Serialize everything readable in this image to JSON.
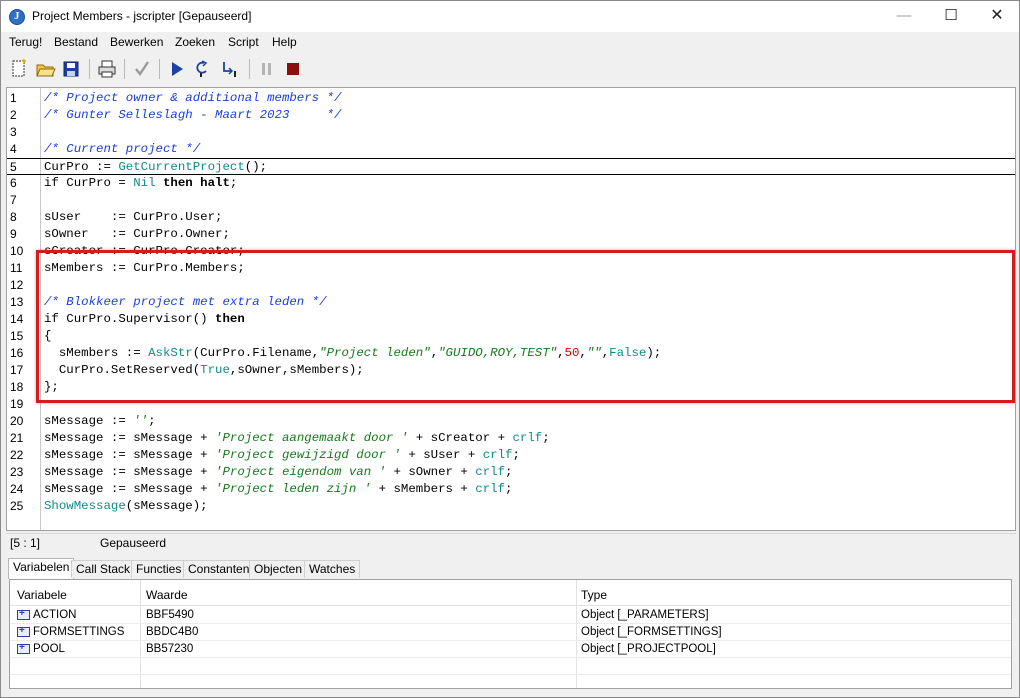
{
  "window": {
    "title": "Project Members - jscripter [Gepauseerd]",
    "controls": {
      "minimize": "—",
      "maximize": "☐",
      "close": "✕"
    }
  },
  "menu": [
    "Terug!",
    "Bestand",
    "Bewerken",
    "Zoeken",
    "Script",
    "Help"
  ],
  "toolbar": [
    "new-icon",
    "open-folder-icon",
    "save-icon",
    "print-icon",
    "check-icon",
    "run-icon",
    "step-over-icon",
    "step-into-icon",
    "pause-icon",
    "stop-icon"
  ],
  "editor": {
    "current_line": 5,
    "lines": [
      {
        "n": "1",
        "html": "<span class=\"cm\">/* Project owner &amp; additional members */</span>"
      },
      {
        "n": "2",
        "html": "<span class=\"cm\">/* Gunter Selleslagh - Maart 2023     */</span>"
      },
      {
        "n": "3",
        "html": ""
      },
      {
        "n": "4",
        "html": "<span class=\"cm\">/* Current project */</span>"
      },
      {
        "n": "5",
        "html": "CurPro := <span class=\"fn\">GetCurrentProject</span>();"
      },
      {
        "n": "6",
        "html": "if CurPro = <span class=\"fn\">Nil</span> <span class=\"kw\">then</span> <span class=\"kw\">halt</span>;"
      },
      {
        "n": "7",
        "html": ""
      },
      {
        "n": "8",
        "html": "sUser    := CurPro.User;"
      },
      {
        "n": "9",
        "html": "sOwner   := CurPro.Owner;"
      },
      {
        "n": "10",
        "html": "sCreator := CurPro.Creator;"
      },
      {
        "n": "11",
        "html": "sMembers := CurPro.Members;"
      },
      {
        "n": "12",
        "html": ""
      },
      {
        "n": "13",
        "html": "<span class=\"cm\">/* Blokkeer project met extra leden */</span>"
      },
      {
        "n": "14",
        "html": "if CurPro.Supervisor() <span class=\"kw\">then</span>"
      },
      {
        "n": "15",
        "html": "{"
      },
      {
        "n": "16",
        "html": "  sMembers := <span class=\"fn\">AskStr</span>(CurPro.Filename,<span class=\"str\">\"Project leden\"</span>,<span class=\"str\">\"GUIDO,ROY,TEST\"</span>,<span class=\"num\">50</span>,<span class=\"str\">\"\"</span>,<span class=\"fn\">False</span>);"
      },
      {
        "n": "17",
        "html": "  CurPro.SetReserved(<span class=\"fn\">True</span>,sOwner,sMembers);"
      },
      {
        "n": "18",
        "html": "};"
      },
      {
        "n": "19",
        "html": ""
      },
      {
        "n": "20",
        "html": "sMessage := <span class=\"str\">''</span>;"
      },
      {
        "n": "21",
        "html": "sMessage := sMessage + <span class=\"str\">'Project aangemaakt door '</span> + sCreator + <span class=\"fn\">crlf</span>;"
      },
      {
        "n": "22",
        "html": "sMessage := sMessage + <span class=\"str\">'Project gewijzigd door '</span> + sUser + <span class=\"fn\">crlf</span>;"
      },
      {
        "n": "23",
        "html": "sMessage := sMessage + <span class=\"str\">'Project eigendom van '</span> + sOwner + <span class=\"fn\">crlf</span>;"
      },
      {
        "n": "24",
        "html": "sMessage := sMessage + <span class=\"str\">'Project leden zijn '</span> + sMembers + <span class=\"fn\">crlf</span>;"
      },
      {
        "n": "25",
        "html": "<span class=\"fn\">ShowMessage</span>(sMessage);"
      }
    ]
  },
  "status": {
    "position": "[5 : 1]",
    "state": "Gepauseerd"
  },
  "tabs": [
    "Variabelen",
    "Call Stack",
    "Functies",
    "Constanten",
    "Objecten",
    "Watches"
  ],
  "variables": {
    "headers": [
      "Variabele",
      "Waarde",
      "Type"
    ],
    "rows": [
      {
        "name": "ACTION",
        "value": "BBF5490",
        "type": "Object [_PARAMETERS]"
      },
      {
        "name": "FORMSETTINGS",
        "value": "BBDC4B0",
        "type": "Object [_FORMSETTINGS]"
      },
      {
        "name": "POOL",
        "value": "BB57230",
        "type": "Object [_PROJECTPOOL]"
      }
    ]
  }
}
